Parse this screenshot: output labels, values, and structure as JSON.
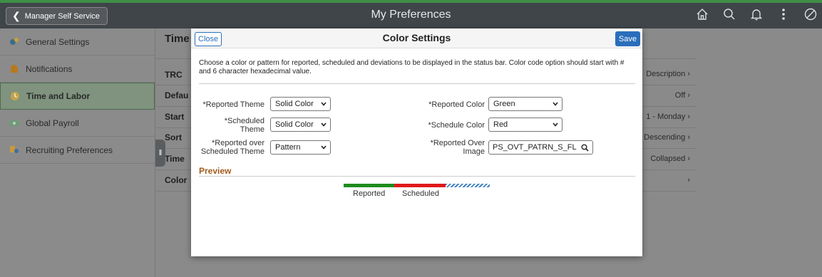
{
  "header": {
    "back_label": "Manager Self Service",
    "title": "My Preferences",
    "icons": [
      "home-icon",
      "search-icon",
      "bell-icon",
      "more-icon",
      "navbar-icon"
    ]
  },
  "sidebar": {
    "items": [
      {
        "label": "General Settings",
        "icon": "gear-person-icon"
      },
      {
        "label": "Notifications",
        "icon": "bell-warning-icon"
      },
      {
        "label": "Time and Labor",
        "icon": "clock-icon",
        "active": true
      },
      {
        "label": "Global Payroll",
        "icon": "payroll-icon"
      },
      {
        "label": "Recruiting Preferences",
        "icon": "recruiting-icon"
      }
    ]
  },
  "content": {
    "title": "Time",
    "rows": [
      {
        "label": "TRC",
        "value": "Description"
      },
      {
        "label": "Defau",
        "value": "Off"
      },
      {
        "label": "Start",
        "value": "1 - Monday"
      },
      {
        "label": "Sort",
        "value": "Descending"
      },
      {
        "label": "Time",
        "value": "Collapsed"
      },
      {
        "label": "Color",
        "value": ""
      }
    ]
  },
  "modal": {
    "close_label": "Close",
    "title": "Color Settings",
    "save_label": "Save",
    "instructions": "Choose a color or pattern for reported, scheduled and deviations to be displayed in the status bar. Color code option should start with # and 6 character hexadecimal value.",
    "fields": {
      "reported_theme": {
        "label": "*Reported Theme",
        "value": "Solid Color"
      },
      "scheduled_theme": {
        "label": "*Scheduled Theme",
        "value": "Solid Color"
      },
      "reported_over_scheduled_theme": {
        "label": "*Reported over Scheduled Theme",
        "value": "Pattern"
      },
      "reported_color": {
        "label": "*Reported Color",
        "value": "Green"
      },
      "schedule_color": {
        "label": "*Schedule Color",
        "value": "Red"
      },
      "reported_over_image": {
        "label": "*Reported Over Image",
        "value": "PS_OVT_PATRN_S_FL"
      }
    },
    "preview": {
      "title": "Preview",
      "reported_label": "Reported",
      "scheduled_label": "Scheduled",
      "colors": {
        "reported": "#1e8c1e",
        "scheduled": "#e01919",
        "pattern": "#3f7fbf"
      }
    }
  },
  "colors": {
    "accent": "#2a6ebb",
    "topbar": "#3f4549",
    "brand_green": "#3f8f45"
  }
}
